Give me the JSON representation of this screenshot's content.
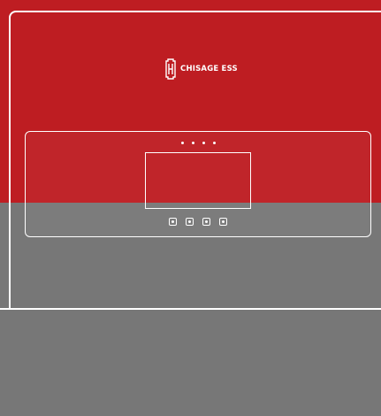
{
  "brand": {
    "name": "CHISAGE ESS",
    "logo_icon": "chisage-logo-icon"
  },
  "colors": {
    "primary_red": "#be1d22",
    "background_gray": "#777777",
    "outline": "#ffffff"
  },
  "device": {
    "indicator_leds": [
      "led",
      "led",
      "led",
      "led"
    ],
    "display_screen": "blank",
    "control_buttons": [
      "button",
      "button",
      "button",
      "button"
    ]
  }
}
